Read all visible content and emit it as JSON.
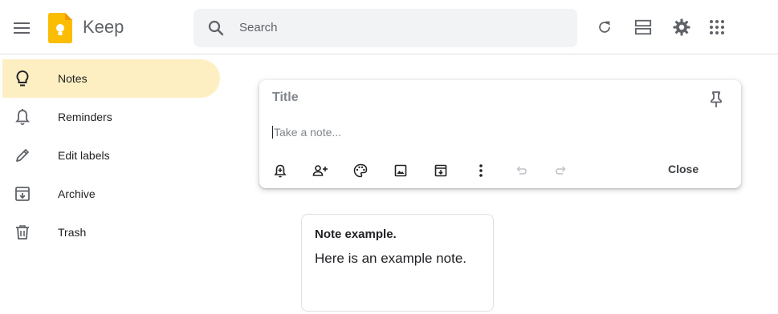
{
  "app": {
    "title": "Keep"
  },
  "header": {
    "search_placeholder": "Search",
    "icons": [
      "menu-icon",
      "keep-logo",
      "search-icon",
      "refresh-icon",
      "list-view-icon",
      "settings-icon",
      "apps-icon"
    ]
  },
  "sidebar": {
    "items": [
      {
        "label": "Notes",
        "icon": "lightbulb-icon",
        "active": true
      },
      {
        "label": "Reminders",
        "icon": "bell-icon",
        "active": false
      },
      {
        "label": "Edit labels",
        "icon": "pencil-icon",
        "active": false
      },
      {
        "label": "Archive",
        "icon": "archive-icon",
        "active": false
      },
      {
        "label": "Trash",
        "icon": "trash-icon",
        "active": false
      }
    ]
  },
  "composer": {
    "title_placeholder": "Title",
    "body_placeholder": "Take a note...",
    "close_label": "Close",
    "tools": [
      "remind-me-icon",
      "collaborator-icon",
      "background-options-icon",
      "add-image-icon",
      "archive-icon",
      "more-icon",
      "undo-icon",
      "redo-icon"
    ]
  },
  "notes": [
    {
      "title": "Note example.",
      "body": "Here is an example note."
    }
  ],
  "colors": {
    "active_nav": "#feefc3",
    "search_bg": "#f1f3f4",
    "logo_yellow": "#fbbc04",
    "icon_gray": "#5f6368"
  }
}
